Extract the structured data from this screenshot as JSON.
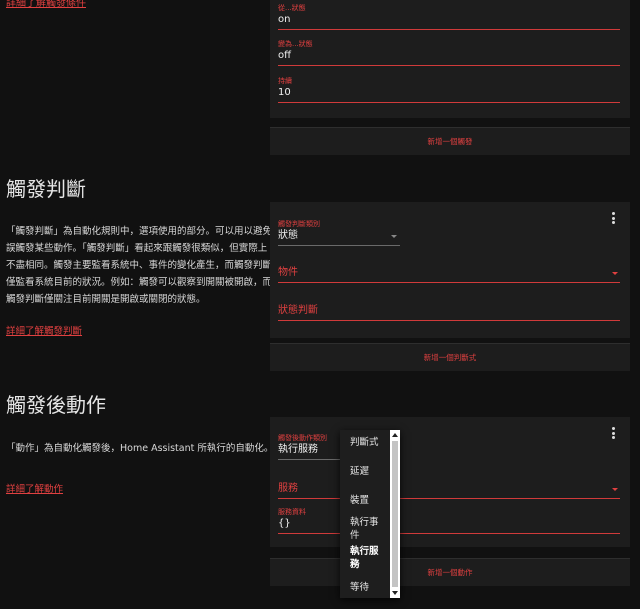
{
  "top_link": "詳細了解觸發條件",
  "trigger_card": {
    "from_label": "從...狀態",
    "from_value": "on",
    "to_label": "變為...狀態",
    "to_value": "off",
    "for_label": "持續",
    "for_value": "10",
    "add_button": "新增一個觸發"
  },
  "conditions": {
    "title": "觸發判斷",
    "description": "「觸發判斷」為自動化規則中，選項使用的部分。可以用以避免誤觸發某些動作。「觸發判斷」看起來跟觸發很類似，但實際上不盡相同。觸發主要監看系統中、事件的變化產生，而觸發判斷僅監看系統目前的狀況。例如：觸發可以觀察到開關被開啟，而觸發判斷僅關注目前開關是開啟或關閉的狀態。",
    "learn_more": "詳細了解觸發判斷",
    "type_label": "觸發判斷類別",
    "type_value": "狀態",
    "entity_placeholder": "物件",
    "state_placeholder": "狀態判斷",
    "add_button": "新增一個判斷式"
  },
  "actions": {
    "title": "觸發後動作",
    "description": "「動作」為自動化觸發後，Home Assistant 所執行的自動化。",
    "learn_more": "詳細了解動作",
    "type_label": "觸發後動作類別",
    "type_value": "執行服務",
    "service_placeholder": "服務",
    "service_data_label": "服務資料",
    "service_data_value": "{}",
    "add_button": "新增一個動作"
  },
  "dropdown": {
    "items": [
      "判斷式",
      "延遲",
      "裝置",
      "執行事件",
      "執行服務",
      "等待"
    ],
    "selected": "執行服務"
  },
  "colors": {
    "accent": "#e04040",
    "background": "#111111",
    "card": "#1d1d1d"
  }
}
